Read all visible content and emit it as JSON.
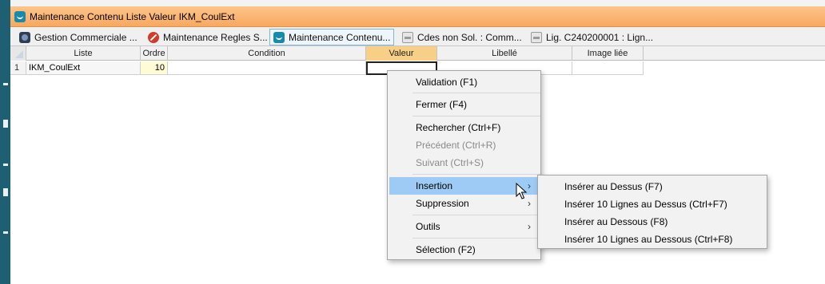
{
  "window": {
    "title": "Maintenance Contenu Liste Valeur IKM_CoulExt"
  },
  "tabs": [
    {
      "label": "Gestion Commerciale ...",
      "icon": "gear-icon",
      "active": false
    },
    {
      "label": "Maintenance Regles S...",
      "icon": "no-entry-icon",
      "active": false
    },
    {
      "label": "Maintenance Contenu...",
      "icon": "app-icon",
      "active": true
    },
    {
      "label": "Cdes non Sol. : Comm...",
      "icon": "printer-icon",
      "active": false
    },
    {
      "label": "Lig. C240200001 : Lign...",
      "icon": "printer-icon",
      "active": false
    }
  ],
  "grid": {
    "columns": [
      "Liste",
      "Ordre",
      "Condition",
      "Valeur",
      "Libellé",
      "Image liée"
    ],
    "selected_column": "Valeur",
    "rows": [
      {
        "num": "1",
        "liste": "IKM_CoulExt",
        "ordre": "10",
        "condition": "",
        "valeur": "",
        "libelle": "",
        "image": ""
      }
    ]
  },
  "context_menu": {
    "validation": "Validation (F1)",
    "fermer": "Fermer (F4)",
    "rechercher": "Rechercher (Ctrl+F)",
    "precedent": "Précédent (Ctrl+R)",
    "suivant": "Suivant (Ctrl+S)",
    "insertion": "Insertion",
    "suppression": "Suppression",
    "outils": "Outils",
    "selection": "Sélection (F2)"
  },
  "submenu_insertion": {
    "inserer_dessus": "Insérer au Dessus (F7)",
    "inserer_10_dessus": "Insérer 10 Lignes au Dessus (Ctrl+F7)",
    "inserer_dessous": "Insérer au Dessous (F8)",
    "inserer_10_dessous": "Insérer 10 Lignes au Dessous (Ctrl+F8)"
  },
  "colors": {
    "titlebar": "#f8a860",
    "selected_header": "#f7cf86",
    "menu_hover": "#9dcbf5",
    "left_strip": "#1e5f74"
  }
}
